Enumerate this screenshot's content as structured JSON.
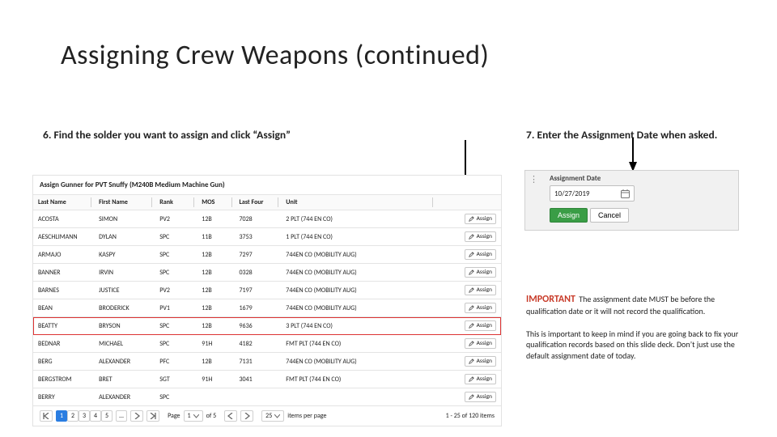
{
  "title": "Assigning Crew Weapons (continued)",
  "step6": "6. Find the solder you want to assign and click “Assign”",
  "step7": "7. Enter the Assignment Date when asked.",
  "panel_title": "Assign Gunner for PVT Snuffy (M240B Medium Machine Gun)",
  "columns": [
    "Last Name",
    "First Name",
    "Rank",
    "MOS",
    "Last Four",
    "Unit",
    ""
  ],
  "assign_label": "Assign",
  "rows": [
    {
      "last": "ACOSTA",
      "first": "SIMON",
      "rank": "PV2",
      "mos": "12B",
      "last4": "7028",
      "unit": "2 PLT (744 EN CO)"
    },
    {
      "last": "AESCHLIMANN",
      "first": "DYLAN",
      "rank": "SPC",
      "mos": "11B",
      "last4": "3753",
      "unit": "1 PLT (744 EN CO)"
    },
    {
      "last": "ARMAJO",
      "first": "KASPY",
      "rank": "SPC",
      "mos": "12B",
      "last4": "7297",
      "unit": "744EN CO (MOBILITY AUG)"
    },
    {
      "last": "BANNER",
      "first": "IRVIN",
      "rank": "SPC",
      "mos": "12B",
      "last4": "0328",
      "unit": "744EN CO (MOBILITY AUG)"
    },
    {
      "last": "BARNES",
      "first": "JUSTICE",
      "rank": "PV2",
      "mos": "12B",
      "last4": "7197",
      "unit": "744EN CO (MOBILITY AUG)"
    },
    {
      "last": "BEAN",
      "first": "BRODERICK",
      "rank": "PV1",
      "mos": "12B",
      "last4": "1679",
      "unit": "744EN CO (MOBILITY AUG)"
    },
    {
      "last": "BEATTY",
      "first": "BRYSON",
      "rank": "SPC",
      "mos": "12B",
      "last4": "9636",
      "unit": "3 PLT (744 EN CO)"
    },
    {
      "last": "BEDNAR",
      "first": "MICHAEL",
      "rank": "SPC",
      "mos": "91H",
      "last4": "4182",
      "unit": "FMT PLT (744 EN CO)"
    },
    {
      "last": "BERG",
      "first": "ALEXANDER",
      "rank": "PFC",
      "mos": "12B",
      "last4": "7131",
      "unit": "744EN CO (MOBILITY AUG)"
    },
    {
      "last": "BERGSTROM",
      "first": "BRET",
      "rank": "SGT",
      "mos": "91H",
      "last4": "3041",
      "unit": "FMT PLT (744 EN CO)"
    },
    {
      "last": "BERRY",
      "first": "ALEXANDER",
      "rank": "SPC",
      "mos": "",
      "last4": "",
      "unit": ""
    }
  ],
  "highlight_row_index": 6,
  "pager": {
    "pages": [
      "1",
      "2",
      "3",
      "4",
      "5"
    ],
    "active": "1",
    "ellipsis": "...",
    "page_label_prefix": "Page",
    "page_label_suffix": "of 5",
    "page_value": "1",
    "per_page_value": "25",
    "per_page_label": "items per page",
    "summary": "1 - 25 of 120 items"
  },
  "date_card": {
    "label": "Assignment Date",
    "value": "10/27/2019",
    "assign": "Assign",
    "cancel": "Cancel"
  },
  "important": {
    "hdr": "IMPORTANT",
    "body1": "The assignment date MUST be before the qualification date or it will not record the qualification.",
    "body2": "This is important to keep in mind if you are going back to fix your qualification records based on this slide deck. Don’t just use the default assignment date of today."
  }
}
